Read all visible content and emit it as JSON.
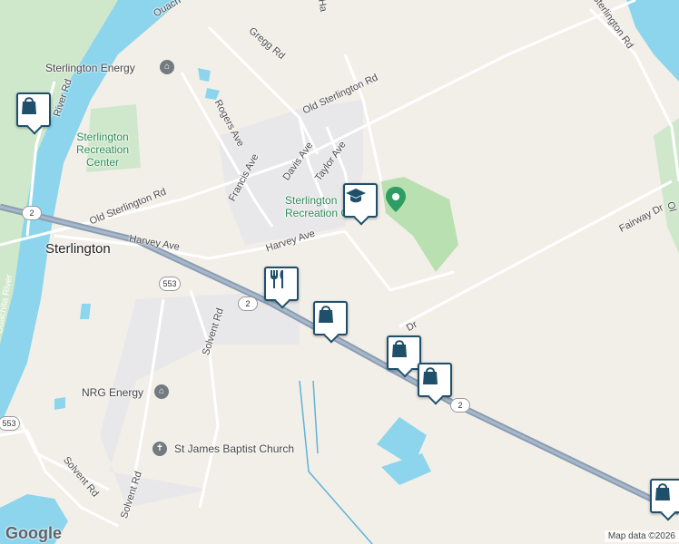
{
  "map": {
    "roads": {
      "hwy2_shield": "2",
      "hwy553_shield": "553",
      "old_sterlington_rd": "Old Sterlington Rd",
      "harvey_ave": "Harvey Ave",
      "rogers_ave": "Rogers Ave",
      "francis_ave": "Francis Ave",
      "davis_ave": "Davis Ave",
      "taylor_ave": "Taylor Ave",
      "gregg_rd": "Gregg Rd",
      "river_rd": "River Rd",
      "solvent_rd": "Solvent Rd",
      "fairway_dr": "Fairway Dr",
      "sterlington_rd": "Sterlington Rd",
      "partial_dr": "Dr",
      "partial_ha": "Ha",
      "partial_ol": "Ol"
    },
    "places": {
      "sterlington": "Sterlington",
      "sterlington_energy": "Sterlington Energy",
      "recreation_center": "Sterlington Recreation Center",
      "recreation_center_lines": [
        "Sterlington",
        "Recreation",
        "Center"
      ],
      "recreation_center_2": "Sterlington Recreation Center",
      "nrg_energy": "NRG Energy",
      "st_james": "St James Baptist Church"
    },
    "water": {
      "ouachita_river": "Ouachita River",
      "ouachita_top": "Ouach"
    },
    "markers": [
      {
        "name": "shopping-bag-marker-1",
        "icon": "shopping-bag-icon"
      },
      {
        "name": "school-marker",
        "icon": "graduation-cap-icon"
      },
      {
        "name": "restaurant-marker",
        "icon": "fork-knife-icon"
      },
      {
        "name": "shopping-bag-marker-2",
        "icon": "shopping-bag-icon"
      },
      {
        "name": "shopping-bag-marker-3",
        "icon": "shopping-bag-icon"
      },
      {
        "name": "shopping-bag-marker-4",
        "icon": "shopping-bag-icon"
      },
      {
        "name": "shopping-bag-marker-5",
        "icon": "shopping-bag-icon"
      }
    ],
    "logo": "Google",
    "attribution": "Map data ©2026",
    "colors": {
      "land": "#f2efe9",
      "water": "#8cd5ed",
      "park": "#c8e6c2",
      "highway": "#8a9db3",
      "marker_border": "#1f4f6b"
    }
  }
}
